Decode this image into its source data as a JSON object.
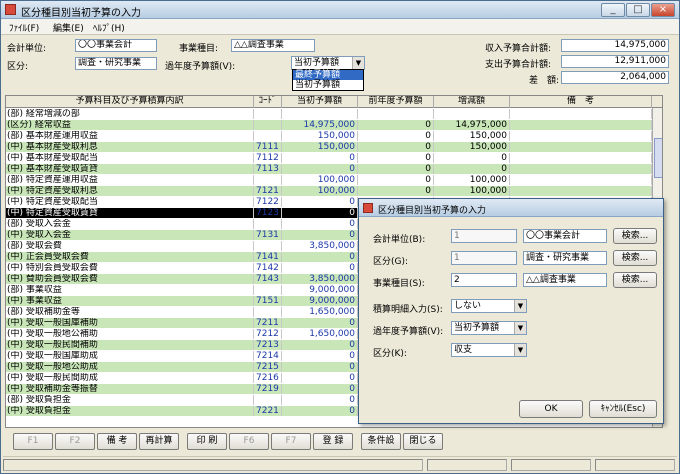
{
  "window": {
    "title": "区分種目別当初予算の入力",
    "menu": [
      "ﾌｧｲﾙ(F)",
      "編集(E)",
      "ﾍﾙﾌﾟ(H)"
    ],
    "minimize": "_",
    "maximize": "□",
    "close": "×"
  },
  "header": {
    "account_unit_label": "会計単位:",
    "account_unit_value": "〇〇事業会計",
    "business_type_label": "事業種目:",
    "business_type_value": "△△調査事業",
    "category_label": "区分:",
    "category_value": "調査・研究事業",
    "past_budget_label": "過年度予算額(V):",
    "past_budget_selected": "当初予算額",
    "past_budget_options": [
      "最終予算額",
      "当初予算額"
    ],
    "income_total_label": "収入予算合計額:",
    "income_total_value": "14,975,000",
    "expense_total_label": "支出予算合計額:",
    "expense_total_value": "12,911,000",
    "difference_label": "差　額:",
    "difference_value": "2,064,000"
  },
  "grid": {
    "columns": [
      "予算科目及び予算積算内訳",
      "ｺｰﾄﾞ",
      "当初予算額",
      "前年度予算額",
      "増減額",
      "備　考"
    ],
    "rows": [
      {
        "name": "(部) 経常増減の部",
        "code": "",
        "budget": "",
        "prev": "",
        "diff": "",
        "style": "w"
      },
      {
        "name": "(区分) 経常収益",
        "code": "",
        "budget": "14,975,000",
        "prev": "0",
        "diff": "14,975,000",
        "style": "g"
      },
      {
        "name": "(部) 基本財産運用収益",
        "code": "",
        "budget": "150,000",
        "prev": "0",
        "diff": "150,000",
        "style": "w"
      },
      {
        "name": "(中) 基本財産受取利息",
        "code": "7111",
        "budget": "150,000",
        "prev": "0",
        "diff": "150,000",
        "style": "g"
      },
      {
        "name": "(中) 基本財産受取配当",
        "code": "7112",
        "budget": "0",
        "prev": "0",
        "diff": "0",
        "style": "w"
      },
      {
        "name": "(中) 基本財産受取賃貸",
        "code": "7113",
        "budget": "0",
        "prev": "0",
        "diff": "0",
        "style": "g"
      },
      {
        "name": "(部) 特定資産運用収益",
        "code": "",
        "budget": "100,000",
        "prev": "0",
        "diff": "100,000",
        "style": "w"
      },
      {
        "name": "(中) 特定資産受取利息",
        "code": "7121",
        "budget": "100,000",
        "prev": "0",
        "diff": "100,000",
        "style": "g"
      },
      {
        "name": "(中) 特定資産受取配当",
        "code": "7122",
        "budget": "0",
        "prev": "",
        "diff": "",
        "style": "w"
      },
      {
        "name": "(中) 特定資産受取賃貸",
        "code": "7123",
        "budget": "0",
        "prev": "",
        "diff": "",
        "style": "sel"
      },
      {
        "name": "(部) 受取入会金",
        "code": "",
        "budget": "0",
        "prev": "",
        "diff": "",
        "style": "w"
      },
      {
        "name": "(中) 受取入会金",
        "code": "7131",
        "budget": "0",
        "prev": "",
        "diff": "",
        "style": "g"
      },
      {
        "name": "(部) 受取会費",
        "code": "",
        "budget": "3,850,000",
        "prev": "",
        "diff": "",
        "style": "w"
      },
      {
        "name": "(中) 正会員受取会費",
        "code": "7141",
        "budget": "0",
        "prev": "",
        "diff": "",
        "style": "g"
      },
      {
        "name": "(中) 特別会員受取会費",
        "code": "7142",
        "budget": "0",
        "prev": "",
        "diff": "",
        "style": "w"
      },
      {
        "name": "(中) 賛助会員受取会費",
        "code": "7143",
        "budget": "3,850,000",
        "prev": "",
        "diff": "",
        "style": "g"
      },
      {
        "name": "(部) 事業収益",
        "code": "",
        "budget": "9,000,000",
        "prev": "",
        "diff": "",
        "style": "w"
      },
      {
        "name": "(中) 事業収益",
        "code": "7151",
        "budget": "9,000,000",
        "prev": "",
        "diff": "",
        "style": "g"
      },
      {
        "name": "(部) 受取補助金等",
        "code": "",
        "budget": "1,650,000",
        "prev": "",
        "diff": "",
        "style": "w"
      },
      {
        "name": "(中) 受取一般国庫補助",
        "code": "7211",
        "budget": "0",
        "prev": "",
        "diff": "",
        "style": "g"
      },
      {
        "name": "(中) 受取一般地公補助",
        "code": "7212",
        "budget": "1,650,000",
        "prev": "",
        "diff": "",
        "style": "w"
      },
      {
        "name": "(中) 受取一般民間補助",
        "code": "7213",
        "budget": "0",
        "prev": "",
        "diff": "",
        "style": "g"
      },
      {
        "name": "(中) 受取一般国庫助成",
        "code": "7214",
        "budget": "0",
        "prev": "",
        "diff": "",
        "style": "w"
      },
      {
        "name": "(中) 受取一般地公助成",
        "code": "7215",
        "budget": "0",
        "prev": "",
        "diff": "",
        "style": "g"
      },
      {
        "name": "(中) 受取一般民間助成",
        "code": "7216",
        "budget": "0",
        "prev": "",
        "diff": "",
        "style": "w"
      },
      {
        "name": "(中) 受取補助金等振替",
        "code": "7219",
        "budget": "0",
        "prev": "",
        "diff": "",
        "style": "g"
      },
      {
        "name": "(部) 受取負担金",
        "code": "",
        "budget": "0",
        "prev": "",
        "diff": "",
        "style": "w"
      },
      {
        "name": "(中) 受取負担金",
        "code": "7221",
        "budget": "0",
        "prev": "",
        "diff": "",
        "style": "g"
      }
    ]
  },
  "footer": {
    "buttons": [
      "F1",
      "F2",
      "備 考",
      "再計算",
      "印 刷",
      "F6",
      "F7",
      "登 録",
      "条件設",
      "閉じる"
    ]
  },
  "dialog": {
    "title": "区分種目別当初予算の入力",
    "account_unit_label": "会計単位(B):",
    "account_unit_code": "1",
    "account_unit_name": "〇〇事業会計",
    "category_label": "区分(G):",
    "category_code": "1",
    "category_name": "調査・研究事業",
    "business_type_label": "事業種目(S):",
    "business_type_code": "2",
    "business_type_name": "△△調査事業",
    "search_label": "検索...",
    "detail_input_label": "積算明細入力(S):",
    "detail_input_value": "しない",
    "past_budget_label": "過年度予算額(V):",
    "past_budget_value": "当初予算額",
    "category_k_label": "区分(K):",
    "category_k_value": "収支",
    "ok_label": "OK",
    "cancel_label": "ｷｬﾝｾﾙ(Esc)"
  }
}
